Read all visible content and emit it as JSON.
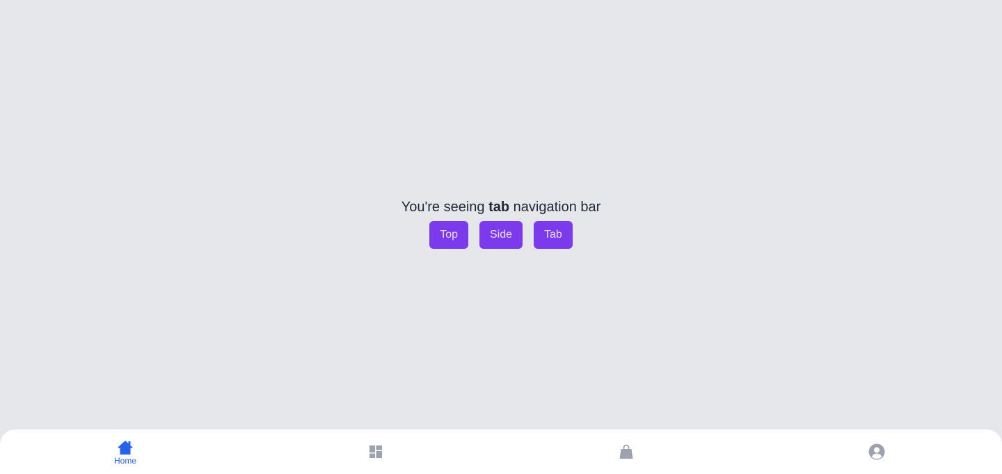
{
  "main": {
    "headline_prefix": "You're seeing ",
    "headline_bold": "tab",
    "headline_suffix": " navigation bar",
    "buttons": [
      {
        "label": "Top"
      },
      {
        "label": "Side"
      },
      {
        "label": "Tab"
      }
    ]
  },
  "tabbar": {
    "items": [
      {
        "label": "Home",
        "icon": "home-icon",
        "active": true
      },
      {
        "label": "",
        "icon": "dashboard-icon",
        "active": false
      },
      {
        "label": "",
        "icon": "shopping-bag-icon",
        "active": false
      },
      {
        "label": "",
        "icon": "user-circle-icon",
        "active": false
      }
    ]
  },
  "colors": {
    "background": "#e5e7eb",
    "button": "#7c3aed",
    "active_tab": "#2563eb",
    "inactive_icon": "#9ca3af"
  }
}
